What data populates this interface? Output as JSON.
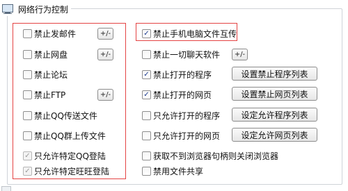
{
  "title": "网络行为控制",
  "left_items": [
    {
      "label": "禁止发邮件",
      "checked": false,
      "disabled": false
    },
    {
      "label": "禁止网盘",
      "checked": false,
      "disabled": false
    },
    {
      "label": "禁止论坛",
      "checked": false,
      "disabled": false
    },
    {
      "label": "禁止FTP",
      "checked": false,
      "disabled": false
    },
    {
      "label": "禁止QQ传送文件",
      "checked": false,
      "disabled": false
    },
    {
      "label": "禁止QQ群上传文件",
      "checked": false,
      "disabled": false
    },
    {
      "label": "只允许特定QQ登陆",
      "checked": true,
      "disabled": true
    },
    {
      "label": "只允许特定旺旺登陆",
      "checked": true,
      "disabled": true
    }
  ],
  "small_button_label": "+/-",
  "right_items": [
    {
      "label": "禁止手机电脑文件互传",
      "checked": true
    },
    {
      "label": "禁止一切聊天软件",
      "checked": false
    },
    {
      "label": "禁止打开的程序",
      "checked": true
    },
    {
      "label": "禁止打开的网页",
      "checked": true
    },
    {
      "label": "只允许打开的程序",
      "checked": false
    },
    {
      "label": "只允许打开的网页",
      "checked": false
    },
    {
      "label": "获取不到浏览器句柄则关闭浏览器",
      "checked": false
    },
    {
      "label": "禁用文件共享",
      "checked": false
    }
  ],
  "buttons": {
    "block_program_list": "设置禁止程序列表",
    "block_web_list": "设置禁止网页列表",
    "allow_program_list": "设定允许程序列表",
    "allow_web_list": "设定允许网页列表"
  },
  "icons": {
    "title_icon": "monitor-icon",
    "check": "✓"
  },
  "colors": {
    "highlight_border": "#e44343",
    "groupbox_border": "#cfd3d8"
  }
}
